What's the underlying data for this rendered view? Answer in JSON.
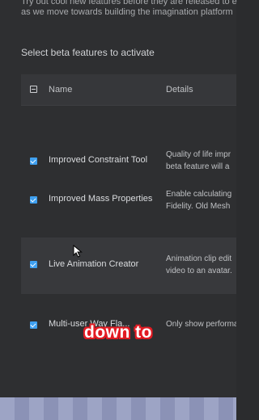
{
  "dialog": {
    "intro_line1": "Try out cool new features before they are released to e",
    "intro_line2": "as we move towards building the imagination platform",
    "section_title": "Select beta features to activate"
  },
  "table": {
    "columns": {
      "name": "Name",
      "details": "Details"
    },
    "rows": [
      {
        "name": "Improved Constraint Tool",
        "details_line1": "Quality of life impr",
        "details_line2": "beta feature will a",
        "checked": true
      },
      {
        "name": "Improved Mass Properties",
        "details_line1": "Enable calculating",
        "details_line2": "Fidelity. Old Mesh",
        "checked": true
      },
      {
        "name": "Live Animation Creator",
        "details_line1": "Animation clip edit",
        "details_line2": "video to an avatar.",
        "checked": true
      },
      {
        "name": "Multi-user Way Fla...",
        "details_line1": "Only show performance",
        "details_line2": "",
        "checked": true
      }
    ]
  },
  "caption": "down to",
  "colors": {
    "accent": "#3fa0f0",
    "caption_outline": "#e31b23"
  }
}
